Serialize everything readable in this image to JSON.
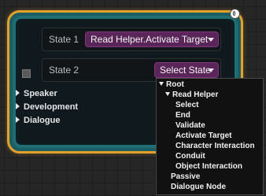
{
  "node": {
    "state1": {
      "label": "State 1",
      "value": "Read Helper.Activate Target"
    },
    "state2": {
      "label": "State 2",
      "value": "Select State"
    },
    "categories": [
      "Speaker",
      "Development",
      "Dialogue"
    ]
  },
  "menu": {
    "root": "Root",
    "read_helper": "Read Helper",
    "read_helper_items": [
      "Select",
      "End",
      "Validate",
      "Activate Target",
      "Character Interaction",
      "Conduit",
      "Object Interaction"
    ],
    "root_items": [
      "Passive",
      "Dialogue Node"
    ]
  },
  "colors": {
    "selection_outline": "#e2a128",
    "dropdown_bg": "#5a2558",
    "node_border": "#1e6e74"
  }
}
